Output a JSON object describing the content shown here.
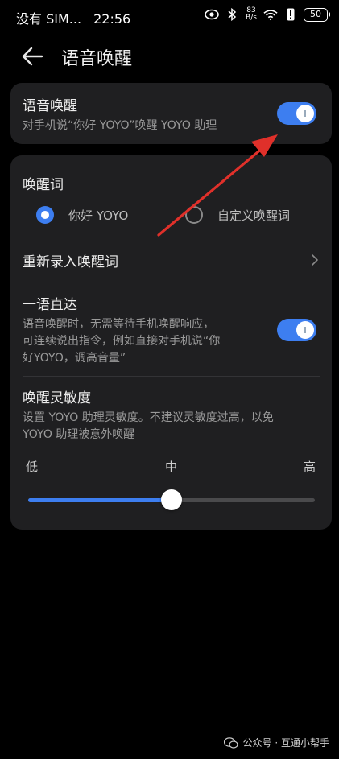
{
  "status_bar": {
    "carrier": "没有 SIM...",
    "time": "22:56",
    "net_speed_top": "83",
    "net_speed_bottom": "B/s",
    "battery": "50"
  },
  "header": {
    "title": "语音唤醒"
  },
  "voice_wake": {
    "title": "语音唤醒",
    "subtitle": "对手机说“你好 YOYO”唤醒 YOYO 助理",
    "enabled": true
  },
  "wake_word": {
    "title": "唤醒词",
    "options": [
      {
        "label": "你好 YOYO",
        "selected": true
      },
      {
        "label": "自定义唤醒词",
        "selected": false
      }
    ]
  },
  "re_record": {
    "title": "重新录入唤醒词"
  },
  "direct": {
    "title": "一语直达",
    "subtitle_lines": [
      "语音唤醒时，无需等待手机唤醒响应，",
      "可连续说出指令，例如直接对手机说“你",
      "好YOYO，调高音量”"
    ],
    "enabled": true
  },
  "sensitivity": {
    "title": "唤醒灵敏度",
    "subtitle_lines": [
      "设置 YOYO 助理灵敏度。不建议灵敏度过高，以免",
      "YOYO 助理被意外唤醒"
    ],
    "low": "低",
    "mid": "中",
    "high": "高",
    "level": 0.5
  },
  "watermark": {
    "text": "公众号 · 互通小帮手"
  },
  "colors": {
    "accent": "#3d7ef0",
    "annotation_arrow": "#e0302a"
  }
}
